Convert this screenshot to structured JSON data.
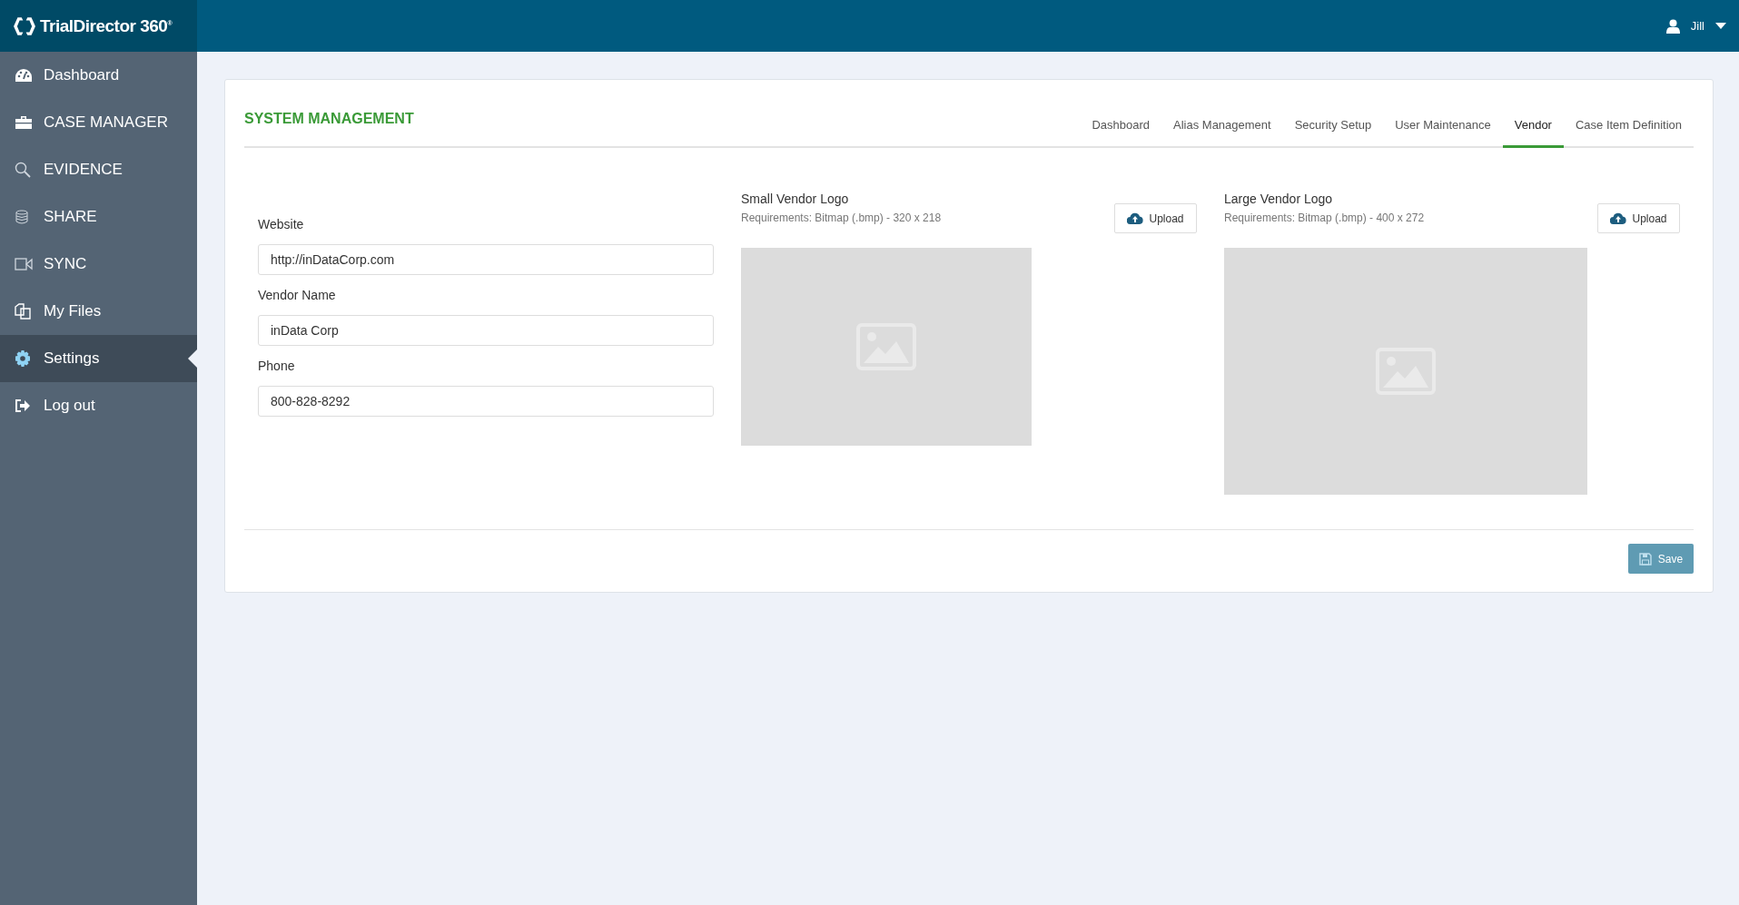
{
  "brand": "TrialDirector 360$^{®}$",
  "user": {
    "name": "Jill"
  },
  "sidebar": {
    "items": [
      {
        "label": "Dashboard",
        "selected": false
      },
      {
        "label": "CASE MANAGER",
        "selected": false
      },
      {
        "label": "EVIDENCE",
        "selected": false
      },
      {
        "label": "SHARE",
        "selected": false
      },
      {
        "label": "SYNC",
        "selected": false
      },
      {
        "label": "My Files",
        "selected": false
      },
      {
        "label": "Settings",
        "selected": true
      },
      {
        "label": "Log out",
        "selected": false
      }
    ]
  },
  "panel": {
    "title": "SYSTEM MANAGEMENT",
    "tabs": [
      {
        "label": "Dashboard",
        "selected": false
      },
      {
        "label": "Alias Management",
        "selected": false
      },
      {
        "label": "Security Setup",
        "selected": false
      },
      {
        "label": "User Maintenance",
        "selected": false
      },
      {
        "label": "Vendor",
        "selected": true
      },
      {
        "label": "Case Item Definition",
        "selected": false
      }
    ],
    "fields": [
      {
        "label": "Website",
        "value": "http://inDataCorp.com"
      },
      {
        "label": "Vendor Name",
        "value": "inData Corp"
      },
      {
        "label": "Phone",
        "value": "800-828-8292"
      }
    ],
    "logos": [
      {
        "title": "Small Vendor Logo",
        "requirements": "Requirements: Bitmap (.bmp) - 320 x 218",
        "button": "Upload"
      },
      {
        "title": "Large Vendor Logo",
        "requirements": "Requirements: Bitmap (.bmp) - 400 x 272",
        "button": "Upload"
      }
    ],
    "save_button": "Save"
  }
}
